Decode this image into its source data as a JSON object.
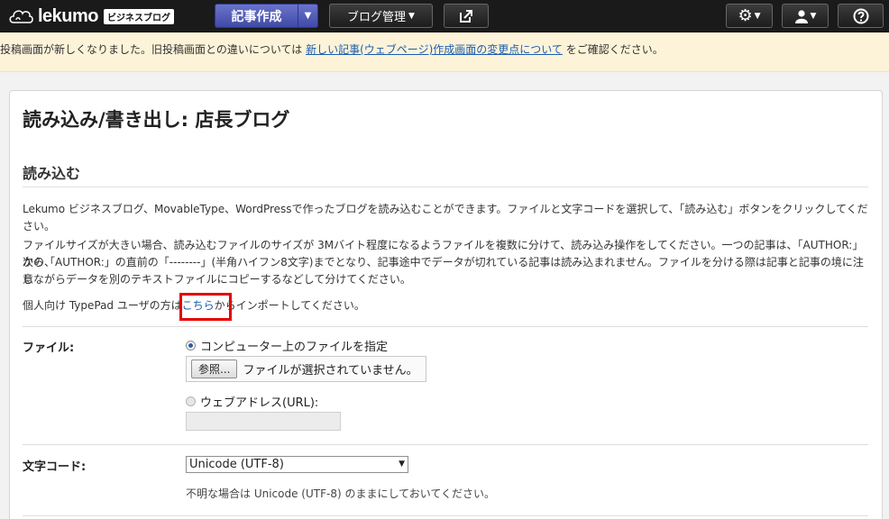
{
  "header": {
    "logo_text": "lekumo",
    "logo_badge": "ビジネスブログ",
    "create_button": "記事作成",
    "manage_button": "ブログ管理",
    "icons": [
      "cloud-logo-icon",
      "caret-down-icon",
      "external-link-icon",
      "gear-icon",
      "user-icon",
      "help-icon"
    ]
  },
  "notice": {
    "text_before": "投稿画面が新しくなりました。旧投稿画面との違いについては",
    "link": "新しい記事(ウェブページ)作成画面の変更点について",
    "text_after": "をご確認ください。"
  },
  "page": {
    "title": "読み込み/書き出し: 店長ブログ",
    "section_title": "読み込む",
    "intro": "Lekumo ビジネスブログ、MovableType、WordPressで作ったブログを読み込むことができます。ファイルと文字コードを選択して、「読み込む」ボタンをクリックしてください。",
    "size_line1": "ファイルサイズが大きい場合、読み込むファイルのサイズが 3Mバイト程度になるようファイルを複数に分けて、読み込み操作をしてください。一つの記事は、「AUTHOR:」から、",
    "size_line2": "次の「AUTHOR:」の直前の「--------」(半角ハイフン8文字)までとなり、記事途中でデータが切れている記事は読み込まれません。ファイルを分ける際は記事と記事の境に注意",
    "size_line3": "しながらデータを別のテキストファイルにコピーするなどして分けてください。",
    "typepad_before": "個人向け TypePad ユーザの方は",
    "typepad_link": "こちら",
    "typepad_after": "からインポートしてください。"
  },
  "form": {
    "file_label": "ファイル:",
    "radio_local": "コンピューター上のファイルを指定",
    "browse_button": "参照...",
    "file_status": "ファイルが選択されていません。",
    "radio_url": "ウェブアドレス(URL):",
    "url_value": "",
    "encoding_label": "文字コード:",
    "encoding_value": "Unicode (UTF-8)",
    "encoding_hint": "不明な場合は Unicode (UTF-8) のままにしておいてください。"
  },
  "colors": {
    "topbar": "#1a1a1a",
    "create_button": "#4a55b5",
    "notice_bg": "#fdf3d9",
    "link": "#1a5db0",
    "highlight": "#e60000"
  }
}
